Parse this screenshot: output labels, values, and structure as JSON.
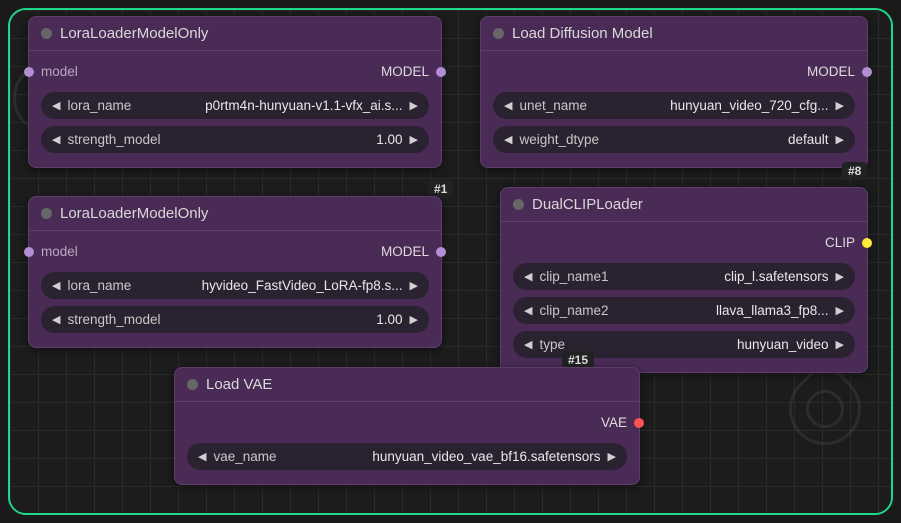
{
  "nodes": {
    "lora1": {
      "title": "LoraLoaderModelOnly",
      "input_label": "model",
      "output_label": "MODEL",
      "lora_name_label": "lora_name",
      "lora_name_value": "p0rtm4n-hunyuan-v1.1-vfx_ai.s...",
      "strength_label": "strength_model",
      "strength_value": "1.00",
      "badge": "#1"
    },
    "lora2": {
      "title": "LoraLoaderModelOnly",
      "input_label": "model",
      "output_label": "MODEL",
      "lora_name_label": "lora_name",
      "lora_name_value": "hyvideo_FastVideo_LoRA-fp8.s...",
      "strength_label": "strength_model",
      "strength_value": "1.00"
    },
    "diffusion": {
      "title": "Load Diffusion Model",
      "output_label": "MODEL",
      "unet_label": "unet_name",
      "unet_value": "hunyuan_video_720_cfg...",
      "dtype_label": "weight_dtype",
      "dtype_value": "default",
      "badge": "#8"
    },
    "clip": {
      "title": "DualCLIPLoader",
      "output_label": "CLIP",
      "clip1_label": "clip_name1",
      "clip1_value": "clip_l.safetensors",
      "clip2_label": "clip_name2",
      "clip2_value": "llava_llama3_fp8...",
      "type_label": "type",
      "type_value": "hunyuan_video",
      "badge": "#15"
    },
    "vae": {
      "title": "Load VAE",
      "output_label": "VAE",
      "vae_label": "vae_name",
      "vae_value": "hunyuan_video_vae_bf16.safetensors"
    }
  }
}
